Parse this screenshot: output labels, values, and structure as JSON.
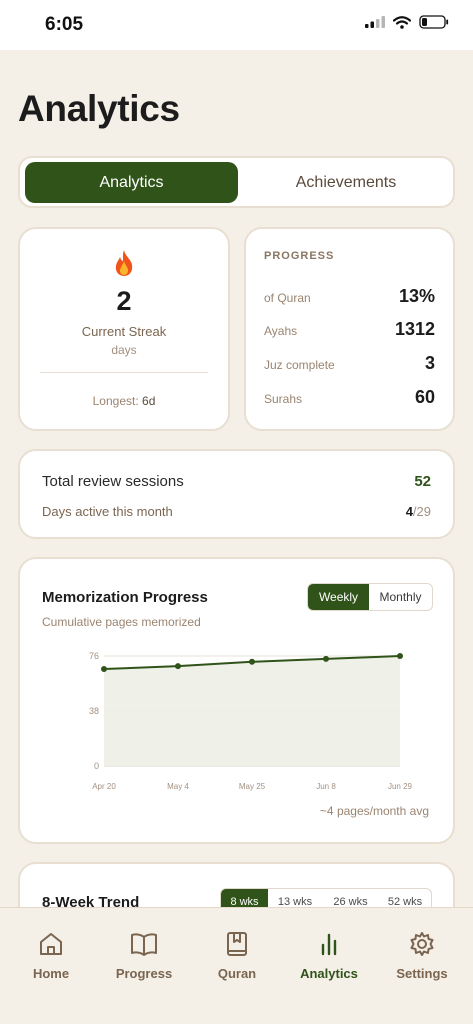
{
  "status_bar": {
    "time": "6:05"
  },
  "page": {
    "title": "Analytics"
  },
  "segment": {
    "active_label": "Analytics",
    "inactive_label": "Achievements"
  },
  "streak": {
    "icon": "flame-icon",
    "value": "2",
    "label": "Current Streak",
    "unit": "days",
    "longest_prefix": "Longest:",
    "longest_value": "6d"
  },
  "progress": {
    "header": "PROGRESS",
    "rows": [
      {
        "label": "of Quran",
        "value": "13%"
      },
      {
        "label": "Ayahs",
        "value": "1312"
      },
      {
        "label": "Juz complete",
        "value": "3"
      },
      {
        "label": "Surahs",
        "value": "60"
      }
    ]
  },
  "sessions": {
    "total_label": "Total review sessions",
    "total_value": "52",
    "active_label": "Days active this month",
    "active_value": "4",
    "active_total": "/29"
  },
  "memorization": {
    "title": "Memorization Progress",
    "subtitle": "Cumulative pages memorized",
    "toggle_weekly": "Weekly",
    "toggle_monthly": "Monthly",
    "footer": "~4 pages/month avg"
  },
  "chart_data": {
    "type": "area",
    "title": "Memorization Progress",
    "subtitle": "Cumulative pages memorized",
    "x": [
      "Apr 20",
      "May 4",
      "May 25",
      "Jun 8",
      "Jun 29"
    ],
    "y_ticks": [
      "76",
      "38",
      "0"
    ],
    "ylim": [
      0,
      76
    ],
    "series": [
      {
        "values": [
          67,
          69,
          72,
          74,
          76
        ]
      }
    ],
    "grid": true,
    "line_color": "#2f5319",
    "fill_color": "#eef0e8"
  },
  "trend": {
    "title": "8-Week Trend",
    "tabs": [
      "8 wks",
      "13 wks",
      "26 wks",
      "52 wks"
    ]
  },
  "nav": {
    "items": [
      {
        "label": "Home",
        "icon": "home-icon"
      },
      {
        "label": "Progress",
        "icon": "book-open-icon"
      },
      {
        "label": "Quran",
        "icon": "quran-book-icon"
      },
      {
        "label": "Analytics",
        "icon": "bar-chart-icon"
      },
      {
        "label": "Settings",
        "icon": "gear-icon"
      }
    ]
  },
  "colors": {
    "accent": "#2f5319",
    "background": "#f4efe7",
    "muted": "#9a8470"
  }
}
